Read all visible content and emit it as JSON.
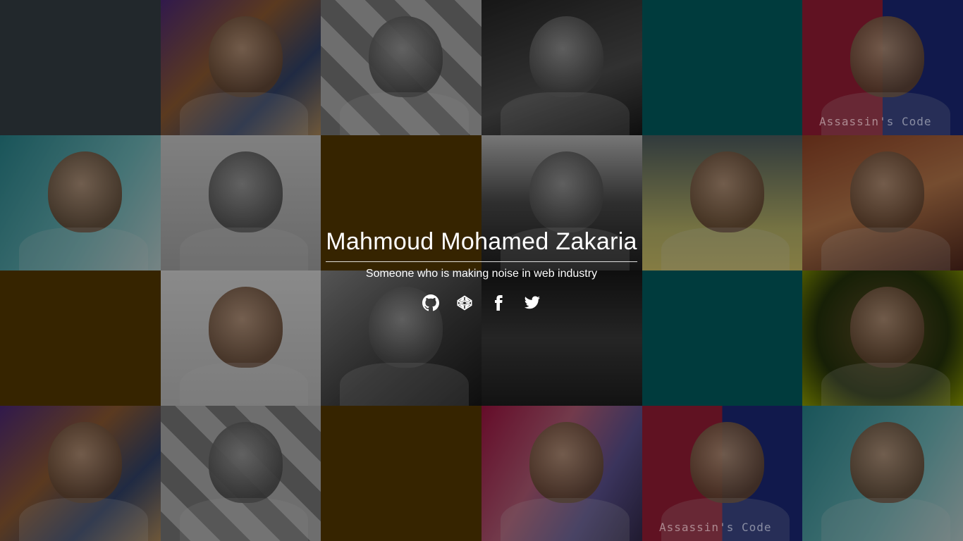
{
  "profile": {
    "name": "Mahmoud Mohamed Zakaria",
    "tagline": "Someone who is making noise in web industry"
  },
  "social_links": [
    {
      "icon": "github-icon",
      "label": "GitHub"
    },
    {
      "icon": "codepen-icon",
      "label": "CodePen"
    },
    {
      "icon": "facebook-icon",
      "label": "Facebook"
    },
    {
      "icon": "twitter-icon",
      "label": "Twitter"
    }
  ],
  "watermark_text": "Assassin's Code",
  "colors": {
    "slate": "#22282c",
    "teal": "#003b3d",
    "brown": "#362400",
    "overlay": "rgba(0,0,0,0.45)",
    "text": "#ffffff"
  }
}
